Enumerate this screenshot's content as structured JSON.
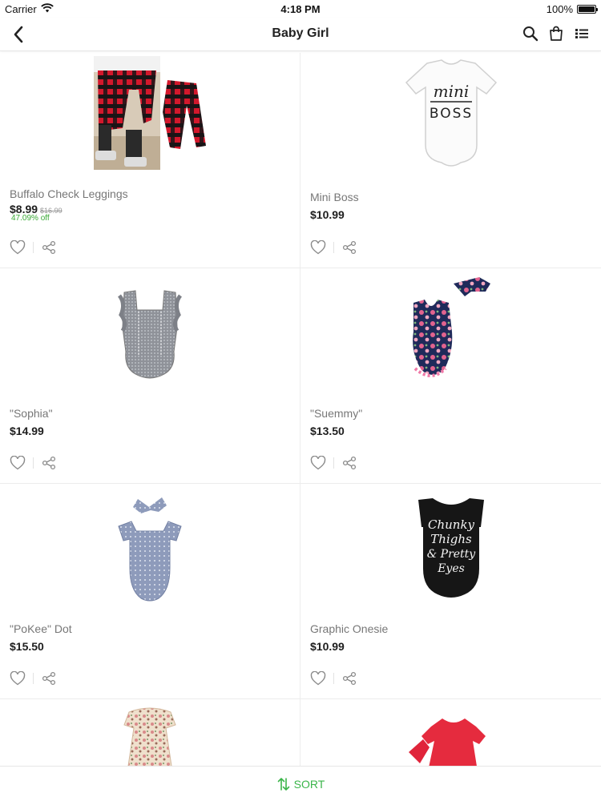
{
  "status_bar": {
    "carrier": "Carrier",
    "time": "4:18 PM",
    "battery": "100%"
  },
  "nav": {
    "title": "Baby Girl"
  },
  "colors": {
    "accent": "#3bb54a",
    "discount": "#39a935",
    "text": "#222222",
    "muted": "#777777",
    "divider": "#ececec"
  },
  "products": [
    {
      "name": "Buffalo Check Leggings",
      "price": "$8.99",
      "old_price": "$16.99",
      "discount": "47.09% off",
      "image": "buffalo-check-leggings"
    },
    {
      "name": "Mini Boss",
      "price": "$10.99",
      "image": "mini-boss-onesie",
      "image_text_1": "mini",
      "image_text_2": "BOSS"
    },
    {
      "name": "\"Sophia\"",
      "price": "$14.99",
      "image": "grey-ruffle-romper"
    },
    {
      "name": "\"Suemmy\"",
      "price": "$13.50",
      "image": "floral-romper-headband"
    },
    {
      "name": "\"PoKee\" Dot",
      "price": "$15.50",
      "image": "polka-dot-romper-headband"
    },
    {
      "name": "Graphic Onesie",
      "price": "$10.99",
      "image": "chunky-thighs-onesie",
      "image_text_1": "Chunky",
      "image_text_2": "Thighs",
      "image_text_3": "& Pretty",
      "image_text_4": "Eyes"
    },
    {
      "image": "floral-dress"
    },
    {
      "image": "red-dress-headband"
    }
  ],
  "sort": {
    "label": "SORT",
    "icon": "sort-arrows-icon"
  },
  "icons": {
    "back": "chevron-left-icon",
    "search": "search-icon",
    "cart": "shopping-bag-icon",
    "list": "list-view-icon",
    "wishlist": "heart-icon",
    "share": "share-icon"
  }
}
